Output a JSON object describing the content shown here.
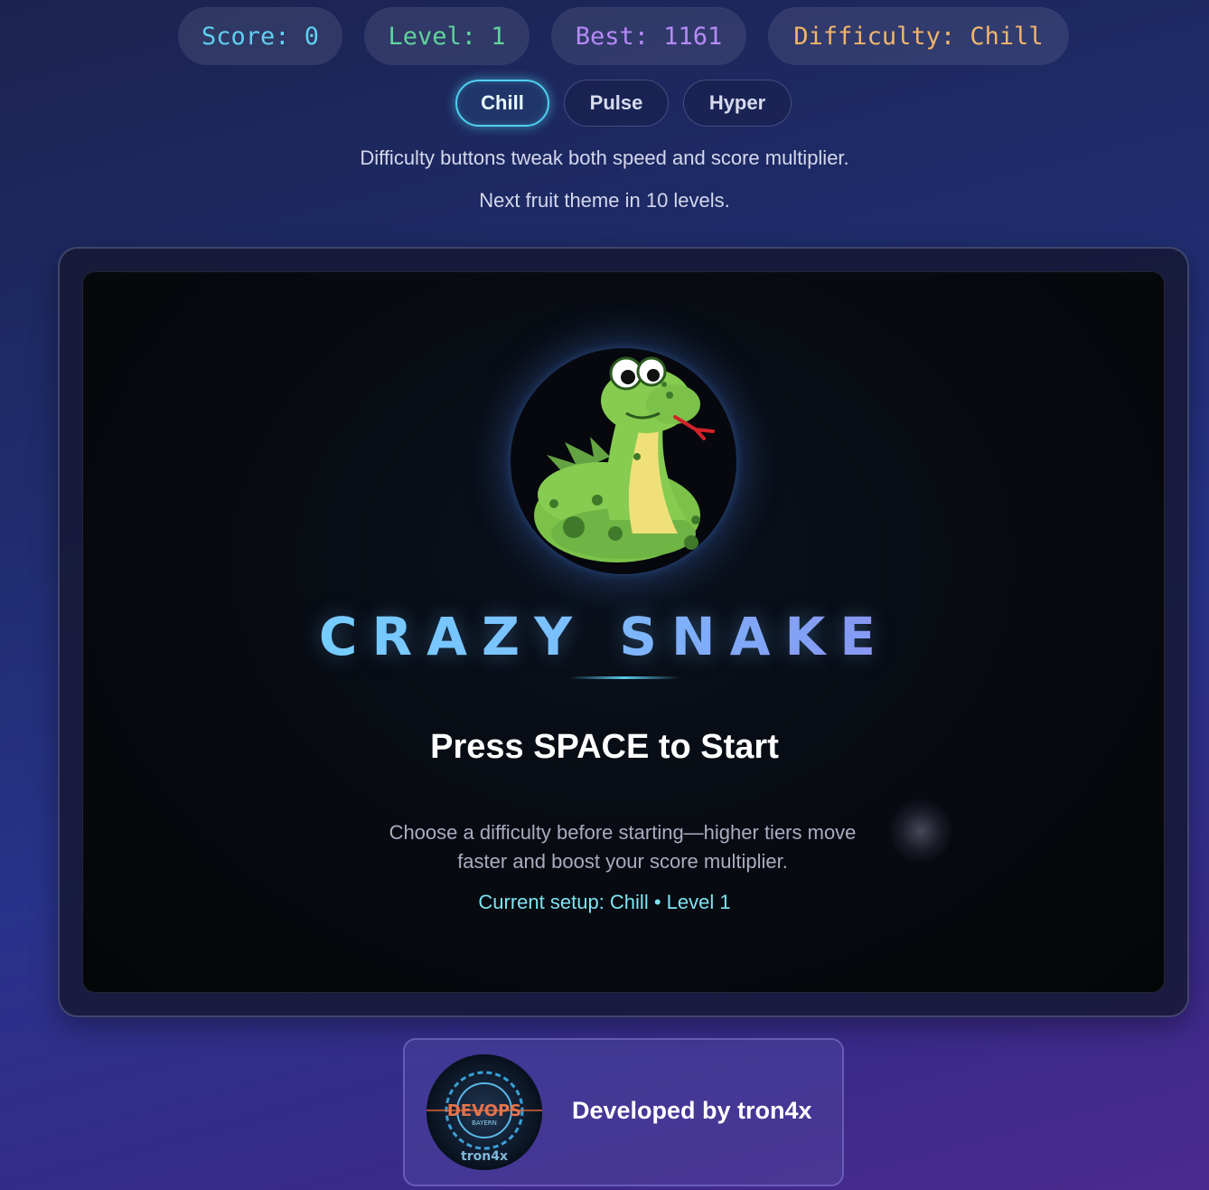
{
  "stats": {
    "score": "Score: 0",
    "level": "Level: 1",
    "best": "Best: 1161",
    "difficulty": "Difficulty: Chill"
  },
  "difficulty_buttons": [
    {
      "label": "Chill",
      "active": true
    },
    {
      "label": "Pulse",
      "active": false
    },
    {
      "label": "Hyper",
      "active": false
    }
  ],
  "hints": {
    "difficulty_hint": "Difficulty buttons tweak both speed and score multiplier.",
    "fruit_theme": "Next fruit theme in 10 levels."
  },
  "start_screen": {
    "title": "CRAZY SNAKE",
    "prompt": "Press SPACE to Start",
    "description": "Choose a difficulty before starting—higher tiers move faster and boost your score multiplier.",
    "current_setup": "Current setup: Chill • Level 1",
    "logo_icon": "snake-mascot-icon"
  },
  "credit": {
    "text": "Developed by tron4x",
    "avatar_text_main": "DEVOPS",
    "avatar_text_sub": "BAYERN",
    "avatar_text_handle": "tron4x"
  },
  "colors": {
    "score": "#5fd0f0",
    "level": "#5fd49b",
    "best": "#b58af5",
    "difficulty": "#f3b56b",
    "accent": "#4fd0f0"
  }
}
